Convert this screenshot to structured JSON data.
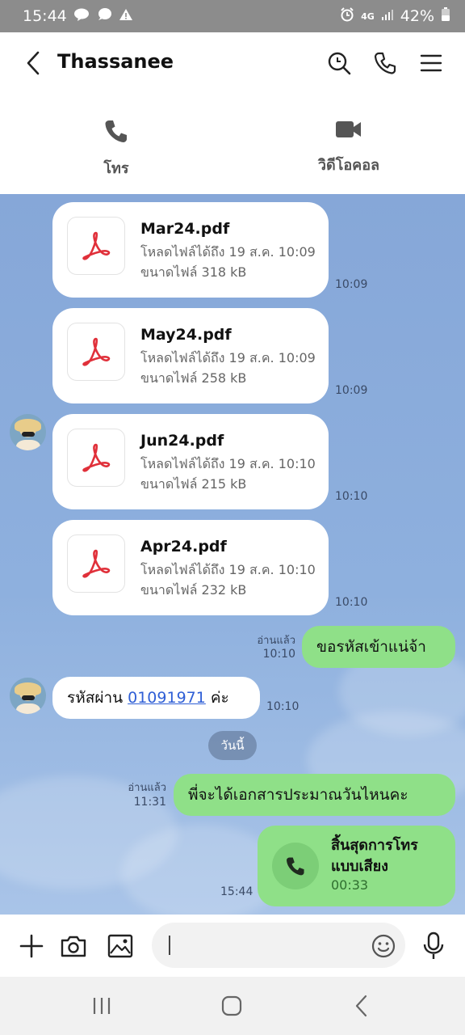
{
  "status_bar": {
    "time": "15:44",
    "network": "4G",
    "battery": "42%",
    "icons": [
      "line-notification-icon",
      "chat-bubble-icon",
      "warning-icon",
      "alarm-icon",
      "signal-icon",
      "battery-icon"
    ]
  },
  "header": {
    "title": "Thassanee",
    "icons": [
      "back-arrow-icon",
      "search-icon",
      "phone-icon",
      "menu-icon"
    ]
  },
  "call_options": {
    "voice_label": "โทร",
    "video_label": "วิดีโอคอล"
  },
  "messages": {
    "files": [
      {
        "name": "Mar24.pdf",
        "expiry": "โหลดไฟล์ได้ถึง 19 ส.ค. 10:09",
        "size": "ขนาดไฟล์ 318 kB",
        "time": "10:09"
      },
      {
        "name": "May24.pdf",
        "expiry": "โหลดไฟล์ได้ถึง 19 ส.ค. 10:09",
        "size": "ขนาดไฟล์ 258 kB",
        "time": "10:09"
      },
      {
        "name": "Jun24.pdf",
        "expiry": "โหลดไฟล์ได้ถึง 19 ส.ค. 10:10",
        "size": "ขนาดไฟล์ 215 kB",
        "time": "10:10"
      },
      {
        "name": "Apr24.pdf",
        "expiry": "โหลดไฟล์ได้ถึง 19 ส.ค. 10:10",
        "size": "ขนาดไฟล์ 232 kB",
        "time": "10:10"
      }
    ],
    "sent_1": {
      "text": "ขอรหัสเข้าแน่จ้า",
      "read": "อ่านแล้ว",
      "time": "10:10"
    },
    "received_password": {
      "prefix": "รหัสผ่าน",
      "link": "01091971",
      "suffix": "ค่ะ",
      "time": "10:10"
    },
    "date_separator": "วันนี้",
    "sent_2": {
      "text": "พี่จะได้เอกสารประมาณวันไหนคะ",
      "read": "อ่านแล้ว",
      "time": "11:31"
    },
    "call_log": {
      "title": "สิ้นสุดการโทรแบบเสียง",
      "duration": "00:33",
      "time": "15:44"
    }
  },
  "input": {
    "placeholder": "",
    "icons": [
      "plus-icon",
      "camera-icon",
      "image-icon",
      "emoji-icon",
      "microphone-icon"
    ]
  },
  "nav": {
    "icons": [
      "recent-apps-icon",
      "home-icon",
      "back-icon"
    ]
  },
  "colors": {
    "chat_background": "#8eb0de",
    "sent_bubble": "#8fe088",
    "link": "#2f5fd6",
    "pdf_red": "#e0303a"
  }
}
